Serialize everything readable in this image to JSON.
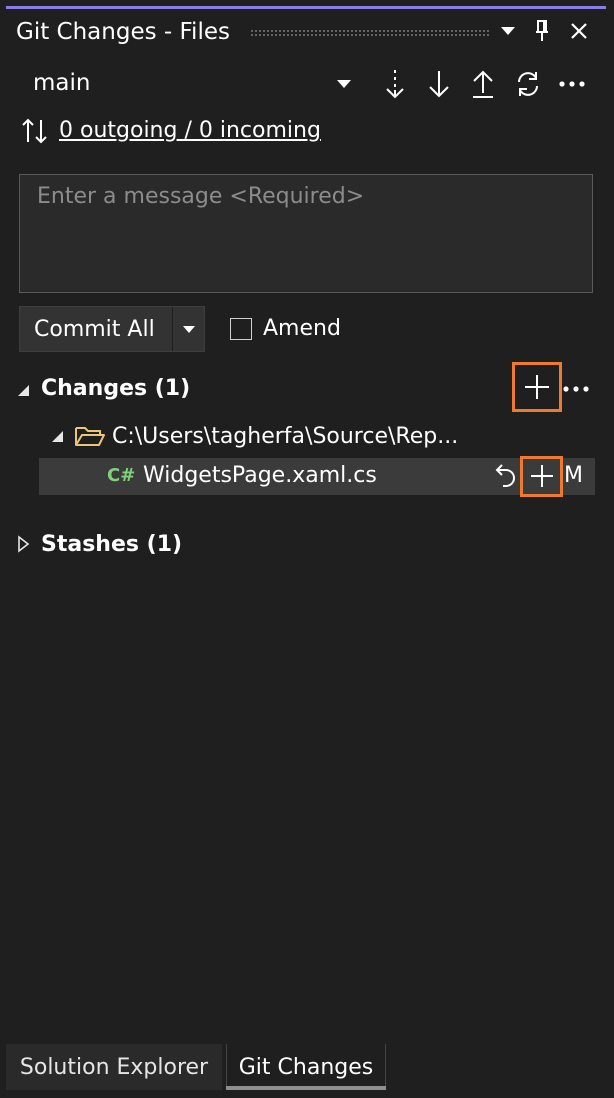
{
  "window": {
    "title": "Git Changes - Files",
    "accent_color": "#8a7de8"
  },
  "title_bar": {
    "icons": [
      "dropdown-icon",
      "pin-icon",
      "close-icon"
    ]
  },
  "branch": {
    "name": "main",
    "toolbar_icons": [
      "fetch-icon",
      "pull-icon",
      "push-icon",
      "sync-icon",
      "more-icon"
    ]
  },
  "sync": {
    "link_text": "0 outgoing / 0 incoming"
  },
  "message": {
    "placeholder": "Enter a message <Required>",
    "value": ""
  },
  "commit": {
    "button_label": "Commit All",
    "amend_label": "Amend",
    "amend_checked": false
  },
  "changes": {
    "header": "Changes (1)",
    "folder_path": "C:\\Users\\tagherfa\\Source\\Rep...",
    "files": [
      {
        "language_icon": "C#",
        "name": "WidgetsPage.xaml.cs",
        "status": "M"
      }
    ]
  },
  "stashes": {
    "header": "Stashes (1)"
  },
  "bottom_tabs": [
    {
      "label": "Solution Explorer",
      "active": false
    },
    {
      "label": "Git Changes",
      "active": true
    }
  ],
  "highlight_color": "#ee7a2d",
  "file_icon_color": "#7fd27a"
}
